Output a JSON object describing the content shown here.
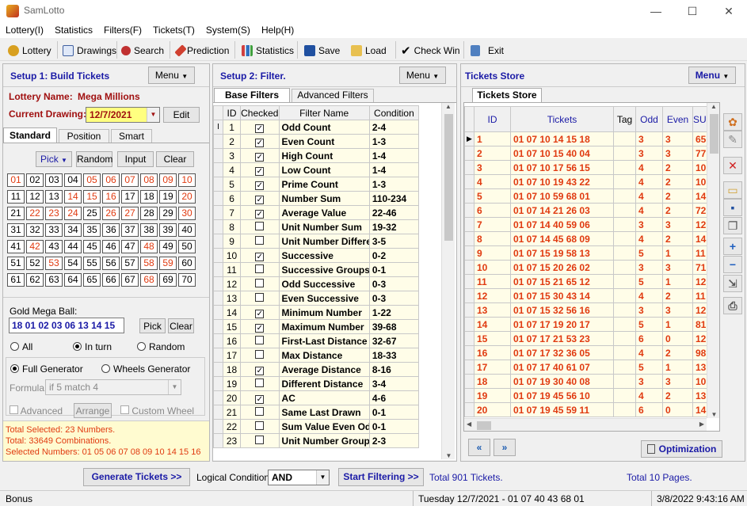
{
  "app": {
    "title": "SamLotto",
    "minimize": "—",
    "maximize": "☐",
    "close": "✕"
  },
  "menu": [
    "Lottery(I)",
    "Statistics",
    "Filters(F)",
    "Tickets(T)",
    "System(S)",
    "Help(H)"
  ],
  "toolbar": [
    {
      "label": "Lottery",
      "icon": "lottery-icon"
    },
    {
      "label": "Drawings",
      "icon": "drawings-icon"
    },
    {
      "label": "Search",
      "icon": "search-icon"
    },
    {
      "label": "Prediction",
      "icon": "prediction-icon"
    },
    {
      "label": "Statistics",
      "icon": "statistics-icon"
    },
    {
      "label": "Save",
      "icon": "save-icon"
    },
    {
      "label": "Load",
      "icon": "load-icon"
    },
    {
      "label": "Check Win",
      "icon": "check-icon"
    },
    {
      "label": "Exit",
      "icon": "exit-icon"
    }
  ],
  "setup1": {
    "title": "Setup 1: Build  Tickets",
    "menu": "Menu",
    "lottery_label": "Lottery  Name:",
    "lottery_name": "Mega Millions",
    "drawing_label": "Current Drawing:",
    "drawing_value": "12/7/2021",
    "edit": "Edit",
    "tabs": [
      "Standard",
      "Position",
      "Smart"
    ],
    "pick": "Pick",
    "random": "Random",
    "input": "Input",
    "clear": "Clear",
    "numbers": [
      "01",
      "02",
      "03",
      "04",
      "05",
      "06",
      "07",
      "08",
      "09",
      "10",
      "11",
      "12",
      "13",
      "14",
      "15",
      "16",
      "17",
      "18",
      "19",
      "20",
      "21",
      "22",
      "23",
      "24",
      "25",
      "26",
      "27",
      "28",
      "29",
      "30",
      "31",
      "32",
      "33",
      "34",
      "35",
      "36",
      "37",
      "38",
      "39",
      "40",
      "41",
      "42",
      "43",
      "44",
      "45",
      "46",
      "47",
      "48",
      "49",
      "50",
      "51",
      "52",
      "53",
      "54",
      "55",
      "56",
      "57",
      "58",
      "59",
      "60",
      "61",
      "62",
      "63",
      "64",
      "65",
      "66",
      "67",
      "68",
      "69",
      "70"
    ],
    "red_numbers": [
      "01",
      "05",
      "06",
      "07",
      "08",
      "09",
      "10",
      "14",
      "15",
      "16",
      "20",
      "22",
      "23",
      "24",
      "26",
      "27",
      "30",
      "42",
      "48",
      "53",
      "58",
      "59",
      "68"
    ],
    "gold_label": "Gold Mega Ball:",
    "gold_value": "18 01 02 03 06 13 14 15",
    "gold_pick": "Pick",
    "gold_clear": "Clear",
    "radio_all": "All",
    "radio_inturn": "In turn",
    "radio_random": "Random",
    "full_gen": "Full Generator",
    "wheels_gen": "Wheels Generator",
    "formula_label": "Formula:",
    "formula_value": "if 5 match 4",
    "advanced": "Advanced",
    "arrange": "Arrange",
    "custom_wheel": "Custom Wheel",
    "summary": [
      "Total Selected: 23 Numbers.",
      "Total: 33649 Combinations.",
      "Selected Numbers: 01 05 06 07 08 09 10 14 15 16"
    ]
  },
  "setup2": {
    "title": "Setup 2: Filter.",
    "menu": "Menu",
    "tabs": [
      "Base Filters",
      "Advanced Filters"
    ],
    "columns": [
      "ID",
      "Checked",
      "Filter Name",
      "Condition"
    ],
    "rows": [
      {
        "id": "1",
        "checked": true,
        "name": "Odd Count",
        "cond": "2-4"
      },
      {
        "id": "2",
        "checked": true,
        "name": "Even Count",
        "cond": "1-3"
      },
      {
        "id": "3",
        "checked": true,
        "name": "High Count",
        "cond": "1-4"
      },
      {
        "id": "4",
        "checked": true,
        "name": "Low Count",
        "cond": "1-4"
      },
      {
        "id": "5",
        "checked": true,
        "name": "Prime Count",
        "cond": "1-3"
      },
      {
        "id": "6",
        "checked": true,
        "name": "Number Sum",
        "cond": "110-234"
      },
      {
        "id": "7",
        "checked": true,
        "name": "Average Value",
        "cond": "22-46"
      },
      {
        "id": "8",
        "checked": false,
        "name": "Unit Number Sum",
        "cond": "19-32"
      },
      {
        "id": "9",
        "checked": false,
        "name": "Unit Number Differe",
        "cond": "3-5"
      },
      {
        "id": "10",
        "checked": true,
        "name": "Successive",
        "cond": "0-2"
      },
      {
        "id": "11",
        "checked": false,
        "name": "Successive Groups",
        "cond": "0-1"
      },
      {
        "id": "12",
        "checked": false,
        "name": "Odd Successive",
        "cond": "0-3"
      },
      {
        "id": "13",
        "checked": false,
        "name": "Even Successive",
        "cond": "0-3"
      },
      {
        "id": "14",
        "checked": true,
        "name": "Minimum Number",
        "cond": "1-22"
      },
      {
        "id": "15",
        "checked": true,
        "name": "Maximum Number",
        "cond": "39-68"
      },
      {
        "id": "16",
        "checked": false,
        "name": "First-Last Distance",
        "cond": "32-67"
      },
      {
        "id": "17",
        "checked": false,
        "name": "Max Distance",
        "cond": "18-33"
      },
      {
        "id": "18",
        "checked": true,
        "name": "Average Distance",
        "cond": "8-16"
      },
      {
        "id": "19",
        "checked": false,
        "name": "Different Distance",
        "cond": "3-4"
      },
      {
        "id": "20",
        "checked": true,
        "name": "AC",
        "cond": "4-6"
      },
      {
        "id": "21",
        "checked": false,
        "name": "Same Last Drawn",
        "cond": "0-1"
      },
      {
        "id": "22",
        "checked": false,
        "name": "Sum Value Even Od",
        "cond": "0-1"
      },
      {
        "id": "23",
        "checked": false,
        "name": "Unit Number Group",
        "cond": "2-3"
      }
    ]
  },
  "store": {
    "title": "Tickets Store",
    "menu": "Menu",
    "tab": "Tickets Store",
    "columns": [
      "ID",
      "Tickets",
      "Tag",
      "Odd",
      "Even",
      "SU"
    ],
    "rows": [
      {
        "id": "1",
        "t": "01 07 10 14 15 18",
        "odd": "3",
        "even": "3",
        "su": "65"
      },
      {
        "id": "2",
        "t": "01 07 10 15 40 04",
        "odd": "3",
        "even": "3",
        "su": "77"
      },
      {
        "id": "3",
        "t": "01 07 10 17 56 15",
        "odd": "4",
        "even": "2",
        "su": "10"
      },
      {
        "id": "4",
        "t": "01 07 10 19 43 22",
        "odd": "4",
        "even": "2",
        "su": "10"
      },
      {
        "id": "5",
        "t": "01 07 10 59 68 01",
        "odd": "4",
        "even": "2",
        "su": "14"
      },
      {
        "id": "6",
        "t": "01 07 14 21 26 03",
        "odd": "4",
        "even": "2",
        "su": "72"
      },
      {
        "id": "7",
        "t": "01 07 14 40 59 06",
        "odd": "3",
        "even": "3",
        "su": "12"
      },
      {
        "id": "8",
        "t": "01 07 14 45 68 09",
        "odd": "4",
        "even": "2",
        "su": "14"
      },
      {
        "id": "9",
        "t": "01 07 15 19 58 13",
        "odd": "5",
        "even": "1",
        "su": "11"
      },
      {
        "id": "10",
        "t": "01 07 15 20 26 02",
        "odd": "3",
        "even": "3",
        "su": "71"
      },
      {
        "id": "11",
        "t": "01 07 15 21 65 12",
        "odd": "5",
        "even": "1",
        "su": "12"
      },
      {
        "id": "12",
        "t": "01 07 15 30 43 14",
        "odd": "4",
        "even": "2",
        "su": "11"
      },
      {
        "id": "13",
        "t": "01 07 15 32 56 16",
        "odd": "3",
        "even": "3",
        "su": "12"
      },
      {
        "id": "14",
        "t": "01 07 17 19 20 17",
        "odd": "5",
        "even": "1",
        "su": "81"
      },
      {
        "id": "15",
        "t": "01 07 17 21 53 23",
        "odd": "6",
        "even": "0",
        "su": "12"
      },
      {
        "id": "16",
        "t": "01 07 17 32 36 05",
        "odd": "4",
        "even": "2",
        "su": "98"
      },
      {
        "id": "17",
        "t": "01 07 17 40 61 07",
        "odd": "5",
        "even": "1",
        "su": "13"
      },
      {
        "id": "18",
        "t": "01 07 19 30 40 08",
        "odd": "3",
        "even": "3",
        "su": "10"
      },
      {
        "id": "19",
        "t": "01 07 19 45 56 10",
        "odd": "4",
        "even": "2",
        "su": "13"
      },
      {
        "id": "20",
        "t": "01 07 19 45 59 11",
        "odd": "6",
        "even": "0",
        "su": "14"
      }
    ],
    "optimization": "Optimization"
  },
  "bottom": {
    "generate": "Generate Tickets >>",
    "logical_label": "Logical Condition:",
    "logical_value": "AND",
    "start_filter": "Start Filtering >>",
    "total_tickets": "Total 901 Tickets.",
    "total_pages": "Total 10 Pages."
  },
  "statusbar": {
    "left": "Bonus",
    "mid": "Tuesday 12/7/2021 - 01 07 40 43 68 01",
    "right": "3/8/2022 9:43:16 AM"
  }
}
